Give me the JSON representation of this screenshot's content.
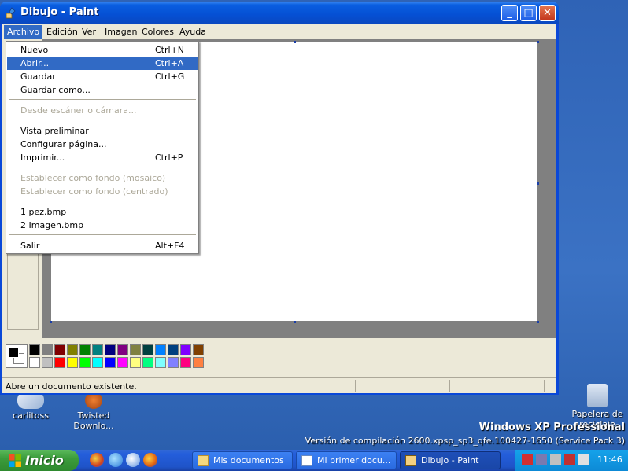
{
  "window": {
    "title": "Dibujo - Paint",
    "min_glyph": "_",
    "max_glyph": "□",
    "close_glyph": "✕"
  },
  "menubar": {
    "items": [
      "Archivo",
      "Edición",
      "Ver",
      "Imagen",
      "Colores",
      "Ayuda"
    ]
  },
  "archivo_menu": {
    "items": [
      {
        "label": "Nuevo",
        "shortcut": "Ctrl+N",
        "state": "normal"
      },
      {
        "label": "Abrir...",
        "shortcut": "Ctrl+A",
        "state": "selected"
      },
      {
        "label": "Guardar",
        "shortcut": "Ctrl+G",
        "state": "normal"
      },
      {
        "label": "Guardar como...",
        "shortcut": "",
        "state": "normal"
      },
      {
        "label": "Desde escáner o cámara...",
        "shortcut": "",
        "state": "disabled"
      },
      {
        "label": "Vista preliminar",
        "shortcut": "",
        "state": "normal"
      },
      {
        "label": "Configurar página...",
        "shortcut": "",
        "state": "normal"
      },
      {
        "label": "Imprimir...",
        "shortcut": "Ctrl+P",
        "state": "normal"
      },
      {
        "label": "Establecer como fondo (mosaico)",
        "shortcut": "",
        "state": "disabled"
      },
      {
        "label": "Establecer como fondo (centrado)",
        "shortcut": "",
        "state": "disabled"
      },
      {
        "label": "1 pez.bmp",
        "shortcut": "",
        "state": "normal"
      },
      {
        "label": "2 Imagen.bmp",
        "shortcut": "",
        "state": "normal"
      },
      {
        "label": "Salir",
        "shortcut": "Alt+F4",
        "state": "normal"
      }
    ]
  },
  "palette": {
    "foreground": "#000000",
    "background": "#ffffff",
    "row1": [
      "#000000",
      "#808080",
      "#800000",
      "#808000",
      "#008000",
      "#008080",
      "#000080",
      "#800080",
      "#808040",
      "#004040",
      "#0080ff",
      "#004080",
      "#8000ff",
      "#804000"
    ],
    "row2": [
      "#ffffff",
      "#c0c0c0",
      "#ff0000",
      "#ffff00",
      "#00ff00",
      "#00ffff",
      "#0000ff",
      "#ff00ff",
      "#ffff80",
      "#00ff80",
      "#80ffff",
      "#8080ff",
      "#ff0080",
      "#ff8040"
    ]
  },
  "status": {
    "text": "Abre un documento existente."
  },
  "desktop": {
    "icons": [
      {
        "label": "carlitoss"
      },
      {
        "label": "Twisted Downlo..."
      },
      {
        "label": "Papelera de reciclaje"
      }
    ],
    "edition": "Windows XP Professional",
    "build": "Versión de compilación 2600.xpsp_sp3_qfe.100427-1650 (Service Pack 3)"
  },
  "taskbar": {
    "start_label": "Inicio",
    "buttons": [
      {
        "label": "Mis documentos",
        "active": false
      },
      {
        "label": "Mi primer docu...",
        "active": false
      },
      {
        "label": "Dibujo - Paint",
        "active": true
      }
    ],
    "clock": "11:46"
  }
}
